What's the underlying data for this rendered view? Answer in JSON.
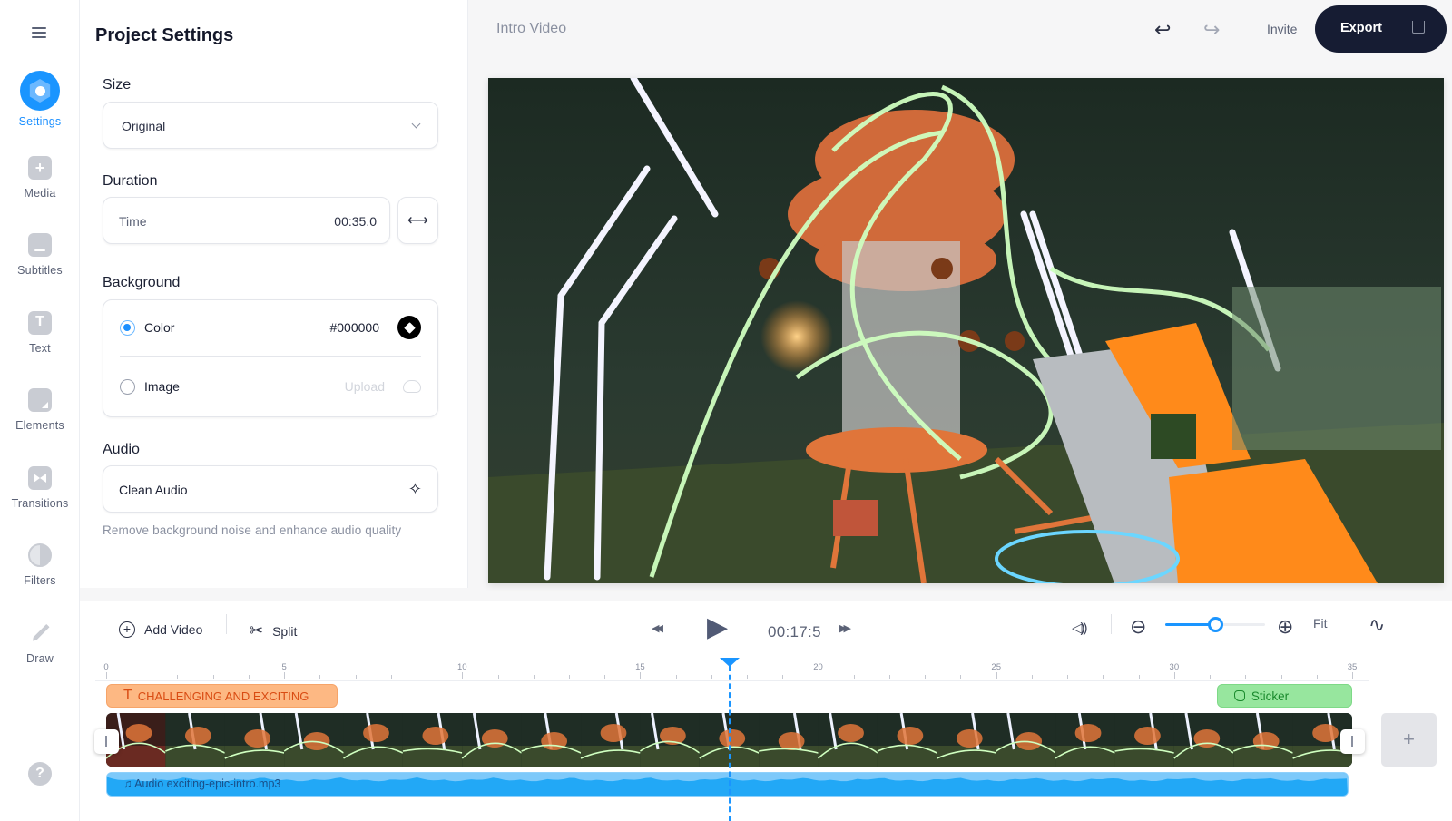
{
  "sidebar": {
    "items": [
      {
        "label": "Settings",
        "icon": "settings-icon",
        "active": true
      },
      {
        "label": "Media",
        "icon": "plus-square-icon"
      },
      {
        "label": "Subtitles",
        "icon": "subtitles-icon"
      },
      {
        "label": "Text",
        "icon": "text-icon"
      },
      {
        "label": "Elements",
        "icon": "sticker-icon"
      },
      {
        "label": "Transitions",
        "icon": "bowtie-icon"
      },
      {
        "label": "Filters",
        "icon": "half-circle-icon"
      },
      {
        "label": "Draw",
        "icon": "pencil-icon"
      }
    ],
    "help": "?"
  },
  "panel": {
    "title": "Project Settings",
    "size": {
      "label": "Size",
      "value": "Original"
    },
    "duration": {
      "label": "Duration",
      "field_label": "Time",
      "value": "00:35.0",
      "swap_glyph": "⟷"
    },
    "background": {
      "label": "Background",
      "color_option": {
        "label": "Color",
        "value": "#000000",
        "selected": true
      },
      "image_option": {
        "label": "Image",
        "action": "Upload",
        "selected": false
      }
    },
    "audio": {
      "label": "Audio",
      "option": "Clean Audio",
      "sparkle": "✧",
      "helper": "Remove background noise and enhance audio quality"
    }
  },
  "topbar": {
    "project_title": "Intro Video",
    "undo_glyph": "↩",
    "redo_glyph": "↪",
    "invite": "Invite",
    "export": "Export"
  },
  "timeline": {
    "add_video": "Add Video",
    "split": "Split",
    "scissors_glyph": "✂",
    "rewind_glyph": "◀◀",
    "play_glyph": "▶",
    "forward_glyph": "▶▶",
    "current_time": "00:17:5",
    "volume_glyph": "◁))",
    "zoom_out_glyph": "⊖",
    "zoom_in_glyph": "⊕",
    "zoom_level": 0.5,
    "fit": "Fit",
    "waveform_glyph": "∿",
    "ruler": {
      "min": 0,
      "max": 35,
      "major_step": 5,
      "minor_step": 1,
      "labels": [
        "0",
        "5",
        "10",
        "15",
        "20",
        "25",
        "30",
        "35"
      ]
    },
    "playhead_seconds": 17.5,
    "text_clip": {
      "glyph": "T",
      "label": "CHALLENGING AND EXCITING",
      "start": 0,
      "end": 6.5
    },
    "sticker_clip": {
      "label": "Sticker",
      "start": 31.2,
      "end": 35
    },
    "video_clip": {
      "start": 0,
      "end": 35
    },
    "audio_clip": {
      "glyph": "♫",
      "label": "Audio exciting-epic-intro.mp3",
      "start": 0,
      "end": 34.9
    },
    "add_clip_glyph": "+"
  }
}
